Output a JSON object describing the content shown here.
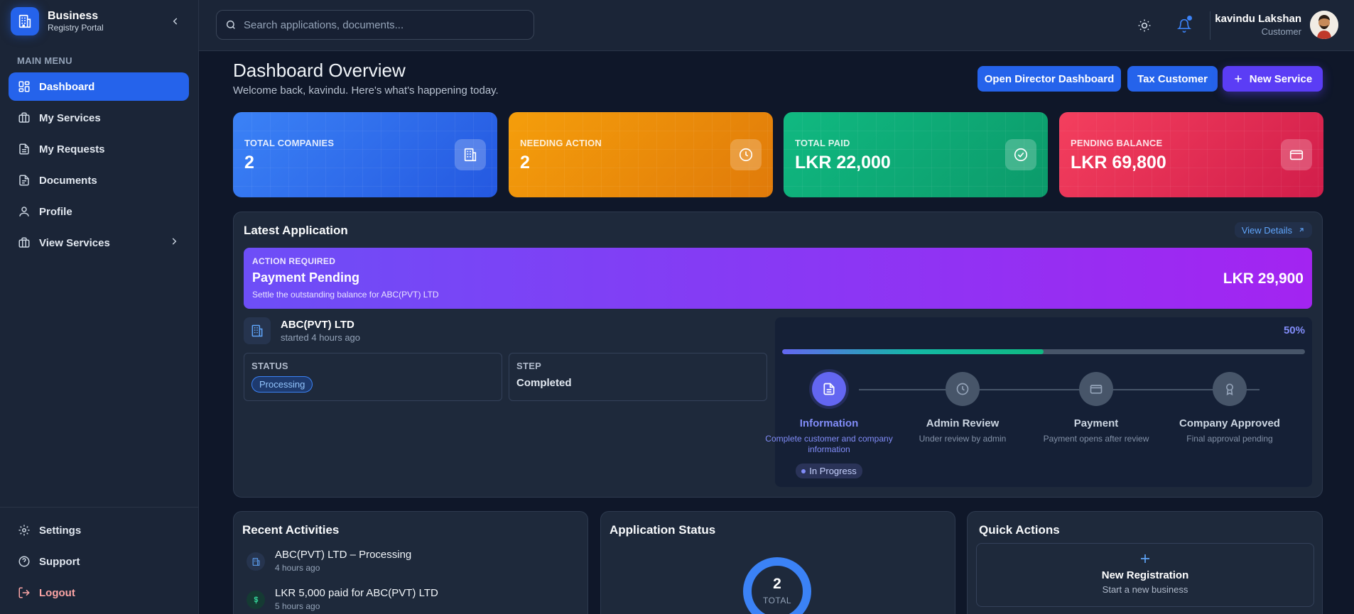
{
  "brand": {
    "title": "Business",
    "subtitle": "Registry Portal"
  },
  "sidebar": {
    "menu_heading": "MAIN MENU",
    "items": [
      {
        "label": "Dashboard",
        "icon": "grid-icon",
        "active": true
      },
      {
        "label": "My Services",
        "icon": "briefcase-icon"
      },
      {
        "label": "My Requests",
        "icon": "document-icon"
      },
      {
        "label": "Documents",
        "icon": "document-icon"
      },
      {
        "label": "Profile",
        "icon": "user-icon"
      },
      {
        "label": "View Services",
        "icon": "briefcase-icon"
      }
    ],
    "bottom_items": [
      {
        "label": "Settings",
        "icon": "gear-icon"
      },
      {
        "label": "Support",
        "icon": "help-icon"
      },
      {
        "label": "Logout",
        "icon": "logout-icon"
      }
    ]
  },
  "topbar": {
    "search_placeholder": "Search applications, documents...",
    "user": {
      "name": "kavindu Lakshan",
      "role": "Customer"
    }
  },
  "header": {
    "title": "Dashboard Overview",
    "subtitle": "Welcome back, kavindu. Here's what's happening today.",
    "buttons": {
      "director": "Open Director Dashboard",
      "tax": "Tax Customer",
      "new_service": "New Service"
    }
  },
  "stats": [
    {
      "label": "TOTAL COMPANIES",
      "value": "2",
      "icon": "building-icon"
    },
    {
      "label": "NEEDING ACTION",
      "value": "2",
      "icon": "clock-icon"
    },
    {
      "label": "TOTAL PAID",
      "value": "LKR 22,000",
      "icon": "check-circle-icon"
    },
    {
      "label": "PENDING BALANCE",
      "value": "LKR 69,800",
      "icon": "card-icon"
    }
  ],
  "latest": {
    "title": "Latest Application",
    "view_details": "View Details",
    "banner": {
      "kicker": "ACTION REQUIRED",
      "title": "Payment Pending",
      "desc": "Settle the outstanding balance for ABC(PVT) LTD",
      "amount": "LKR 29,900"
    },
    "company": {
      "name": "ABC(PVT) LTD",
      "time": "started 4 hours ago"
    },
    "status": {
      "label": "STATUS",
      "value": "Processing"
    },
    "step": {
      "label": "STEP",
      "value": "Completed"
    },
    "progress": {
      "percent_text": "50%",
      "fraction": 0.5
    },
    "steps": [
      {
        "title": "Information",
        "desc": "Complete customer and company information",
        "badge": "In Progress",
        "active": true
      },
      {
        "title": "Admin Review",
        "desc": "Under review by admin"
      },
      {
        "title": "Payment",
        "desc": "Payment opens after review"
      },
      {
        "title": "Company Approved",
        "desc": "Final approval pending"
      }
    ]
  },
  "recent": {
    "title": "Recent Activities",
    "items": [
      {
        "title": "ABC(PVT) LTD – Processing",
        "time": "4 hours ago",
        "icon": "building-icon"
      },
      {
        "title": "LKR 5,000 paid for ABC(PVT) LTD",
        "time": "5 hours ago",
        "icon": "dollar-icon"
      }
    ]
  },
  "app_status": {
    "title": "Application Status",
    "total": "2",
    "total_label": "TOTAL"
  },
  "quick": {
    "title": "Quick Actions",
    "item_title": "New Registration",
    "item_sub": "Start a new business"
  },
  "colors": {
    "primary": "#2563eb",
    "accent_purple": "#5b3df5",
    "bg": "#0f1729",
    "panel": "#1e293b"
  }
}
